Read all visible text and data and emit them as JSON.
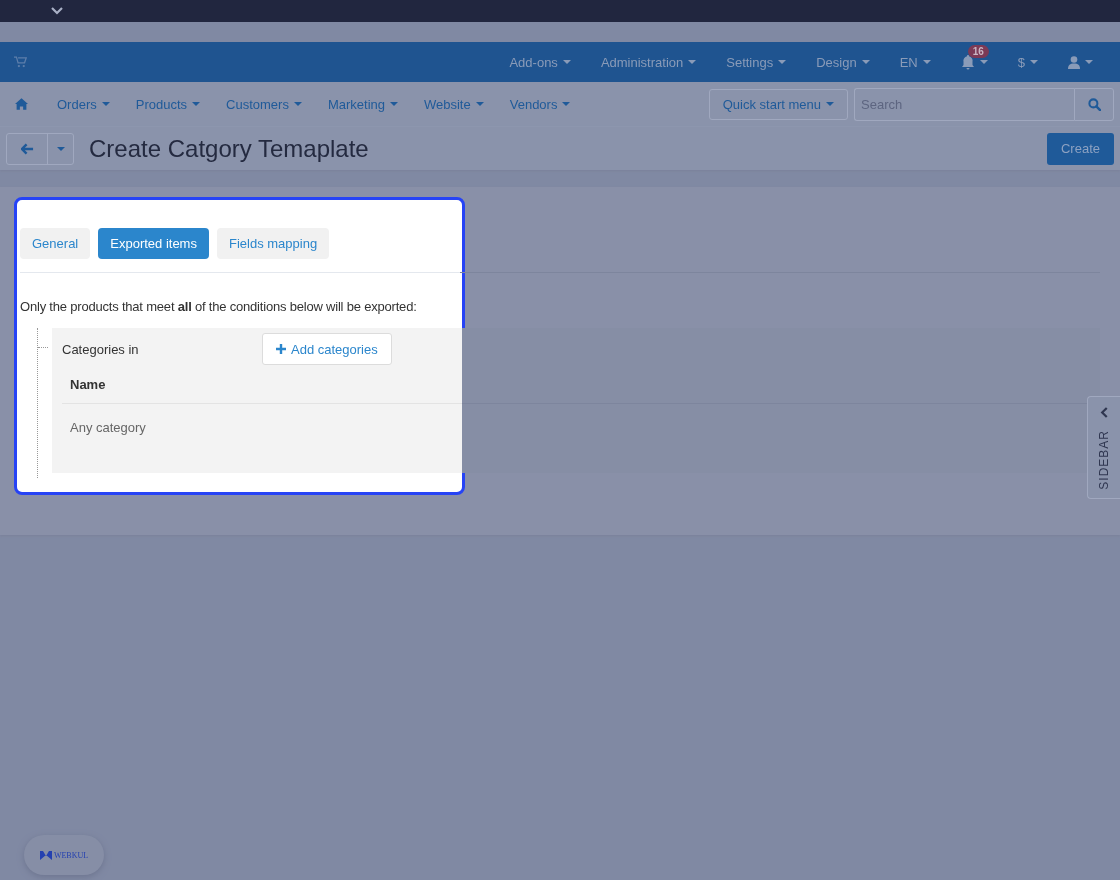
{
  "top_nav": {
    "items": [
      {
        "label": "Add-ons"
      },
      {
        "label": "Administration"
      },
      {
        "label": "Settings"
      },
      {
        "label": "Design"
      },
      {
        "label": "EN"
      }
    ],
    "notifications": {
      "count": "16"
    },
    "currency": {
      "label": "$"
    }
  },
  "main_nav": {
    "items": [
      {
        "label": "Orders"
      },
      {
        "label": "Products"
      },
      {
        "label": "Customers"
      },
      {
        "label": "Marketing"
      },
      {
        "label": "Website"
      },
      {
        "label": "Vendors"
      }
    ],
    "quick_start": "Quick start menu",
    "search": {
      "placeholder": "Search"
    }
  },
  "title_bar": {
    "title": "Create Catgory Temaplate",
    "create_button": "Create"
  },
  "tabs": [
    {
      "label": "General",
      "selected": false
    },
    {
      "label": "Exported items",
      "selected": true
    },
    {
      "label": "Fields mapping",
      "selected": false
    }
  ],
  "conditions": {
    "intro": "Only the products that meet **all** of the conditions below will be exported:",
    "label": "Categories in",
    "add_button": "Add categories",
    "table": {
      "columns": [
        "Name"
      ],
      "rows": [
        [
          "Any category"
        ]
      ]
    }
  },
  "sidebar_toggle": "SIDEBAR",
  "vendor_badge": {
    "logo_text": "WEBKUL"
  }
}
